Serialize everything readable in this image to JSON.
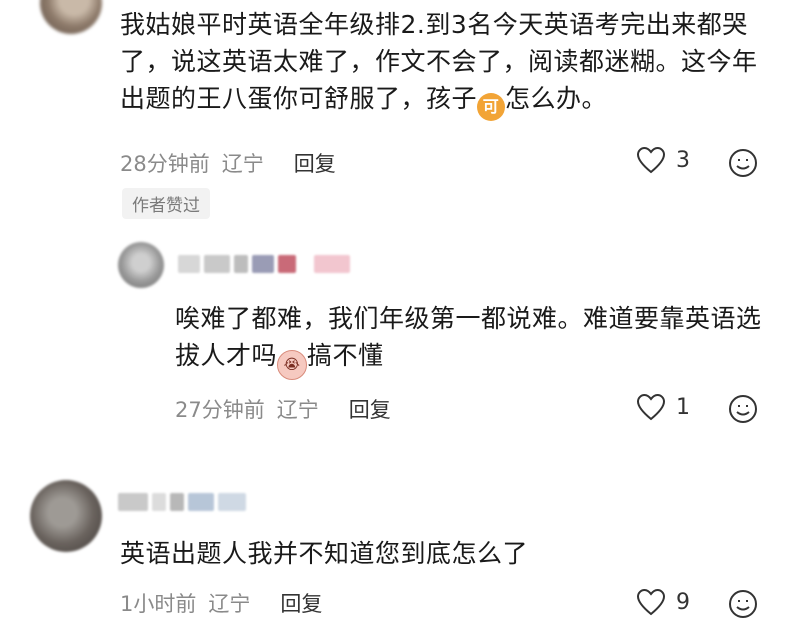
{
  "comments": [
    {
      "text_pre": "我姑娘平时英语全年级排2.到3名今天英语考完出来都哭了，说这英语太难了，作文不会了，阅读都迷糊。这今年出题的王八蛋你可舒服了，孩子",
      "emoji": "可",
      "text_post": "怎么办。",
      "time": "28分钟前",
      "region": "辽宁",
      "reply_label": "回复",
      "likes": "3",
      "author_badge": "作者赞过"
    },
    {
      "text_pre": "唉难了都难，我们年级第一都说难。难道要靠英语选拔人才吗",
      "emoji": "😭",
      "text_post": "搞不懂",
      "time": "27分钟前",
      "region": "辽宁",
      "reply_label": "回复",
      "likes": "1"
    },
    {
      "text_pre": "英语出题人我并不知道您到底怎么了",
      "time": "1小时前",
      "region": "辽宁",
      "reply_label": "回复",
      "likes": "9"
    }
  ],
  "icons": {
    "like": "heart-outline-icon",
    "emoji_react": "smiley-icon"
  },
  "colors": {
    "text": "#1a1a1a",
    "meta": "#8a8a8a",
    "badge_bg": "#f2f2f2",
    "emoji_orange": "#f2a436"
  }
}
